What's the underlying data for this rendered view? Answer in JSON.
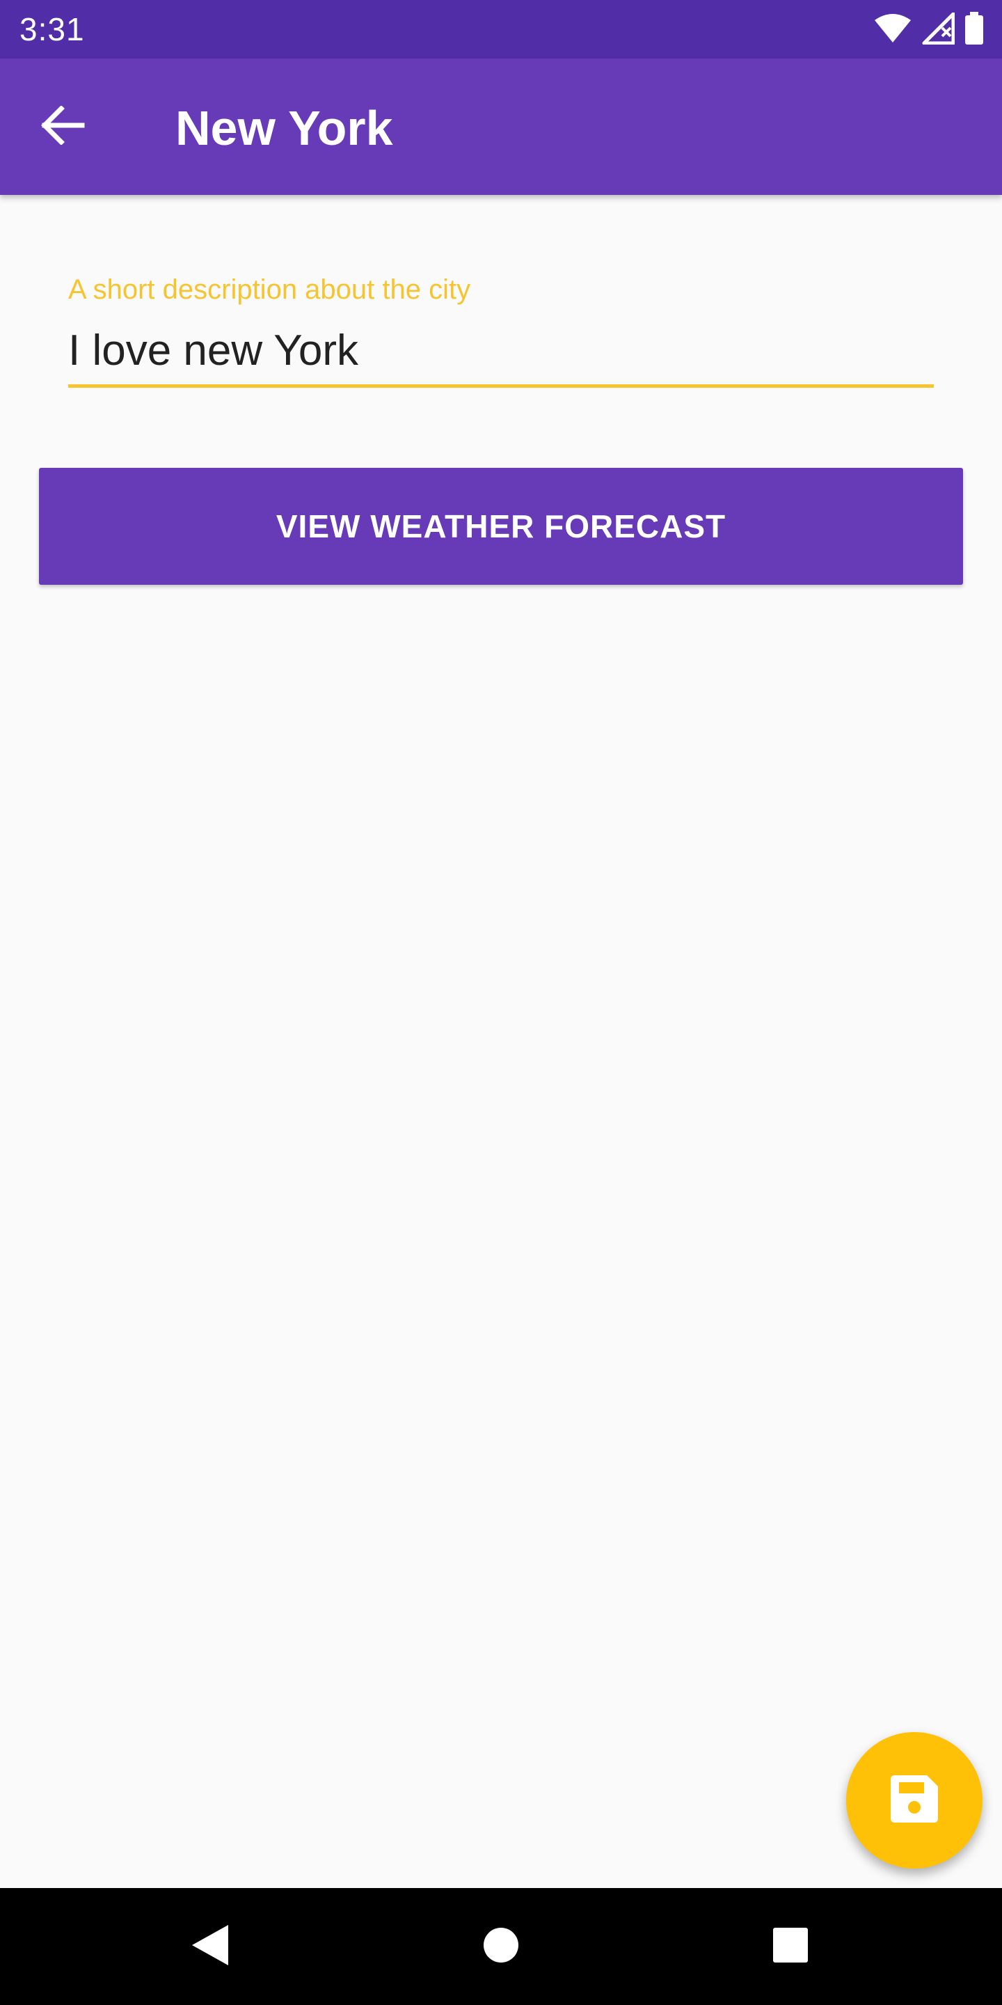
{
  "status_bar": {
    "time": "3:31",
    "icons": [
      "wifi-icon",
      "signal-icon",
      "battery-icon"
    ]
  },
  "app_bar": {
    "title": "New York",
    "back_icon": "arrow-back-icon"
  },
  "description_field": {
    "label": "A short description about the city",
    "value": "I love new York"
  },
  "weather_button": {
    "label": "VIEW WEATHER FORECAST"
  },
  "fab": {
    "icon": "save-icon"
  },
  "nav_bar": {
    "icons": [
      "back-triangle-icon",
      "home-circle-icon",
      "recents-square-icon"
    ]
  },
  "colors": {
    "primary": "#673ab7",
    "primary_dark": "#512da8",
    "accent": "#ffc107",
    "field_accent": "#f7c431",
    "background": "#fafafa"
  }
}
